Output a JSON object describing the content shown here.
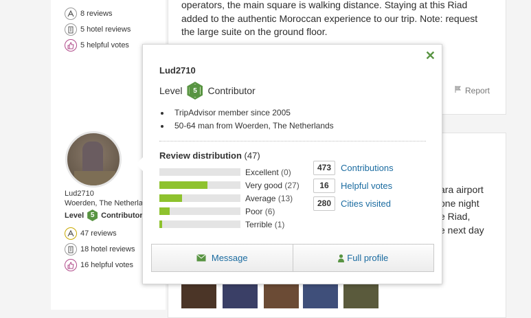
{
  "colors": {
    "brand_green": "#589442",
    "link_blue": "#1a6ba0",
    "bar_green": "#8ec22e"
  },
  "top_reviewer": {
    "stats": [
      {
        "icon": "review-pen-icon",
        "text": "8 reviews"
      },
      {
        "icon": "hotel-icon",
        "text": "5 hotel reviews"
      },
      {
        "icon": "thumbs-up-icon",
        "text": "5 helpful votes"
      }
    ]
  },
  "review1": {
    "lines": [
      "operators, the main square is walking distance. Staying at this Riad",
      "added to the authentic Moroccan experience to our trip. Note: request",
      "the large suite on the ground floor."
    ],
    "report_label": "Report"
  },
  "reviewer2": {
    "name": "Lud2710",
    "location": "Woerden, The Netherla",
    "level_label": "Level",
    "level": "5",
    "level_title": "Contributor",
    "stats": [
      {
        "icon": "review-pen-icon",
        "text": "47 reviews"
      },
      {
        "icon": "hotel-icon",
        "text": "18 hotel reviews"
      },
      {
        "icon": "thumbs-up-icon",
        "text": "16 helpful votes"
      }
    ]
  },
  "review2": {
    "lines": [
      "ara airport",
      "one night",
      "e Riad,",
      "e next day"
    ]
  },
  "popup": {
    "username": "Lud2710",
    "level_prefix": "Level",
    "level_num": "5",
    "level_suffix": "Contributor",
    "bullets": [
      "TripAdvisor member since 2005",
      "50-64 man from Woerden, The Netherlands"
    ],
    "distribution_title": "Review distribution",
    "distribution_total": "(47)",
    "distribution": [
      {
        "label": "Excellent",
        "count": "(0)",
        "fraction": 0.0
      },
      {
        "label": "Very good",
        "count": "(27)",
        "fraction": 0.59
      },
      {
        "label": "Average",
        "count": "(13)",
        "fraction": 0.28
      },
      {
        "label": "Poor",
        "count": "(6)",
        "fraction": 0.13
      },
      {
        "label": "Terrible",
        "count": "(1)",
        "fraction": 0.03
      }
    ],
    "stats": [
      {
        "num": "473",
        "label": "Contributions"
      },
      {
        "num": "16",
        "label": "Helpful votes"
      },
      {
        "num": "280",
        "label": "Cities visited"
      }
    ],
    "message_label": "Message",
    "profile_label": "Full profile"
  }
}
